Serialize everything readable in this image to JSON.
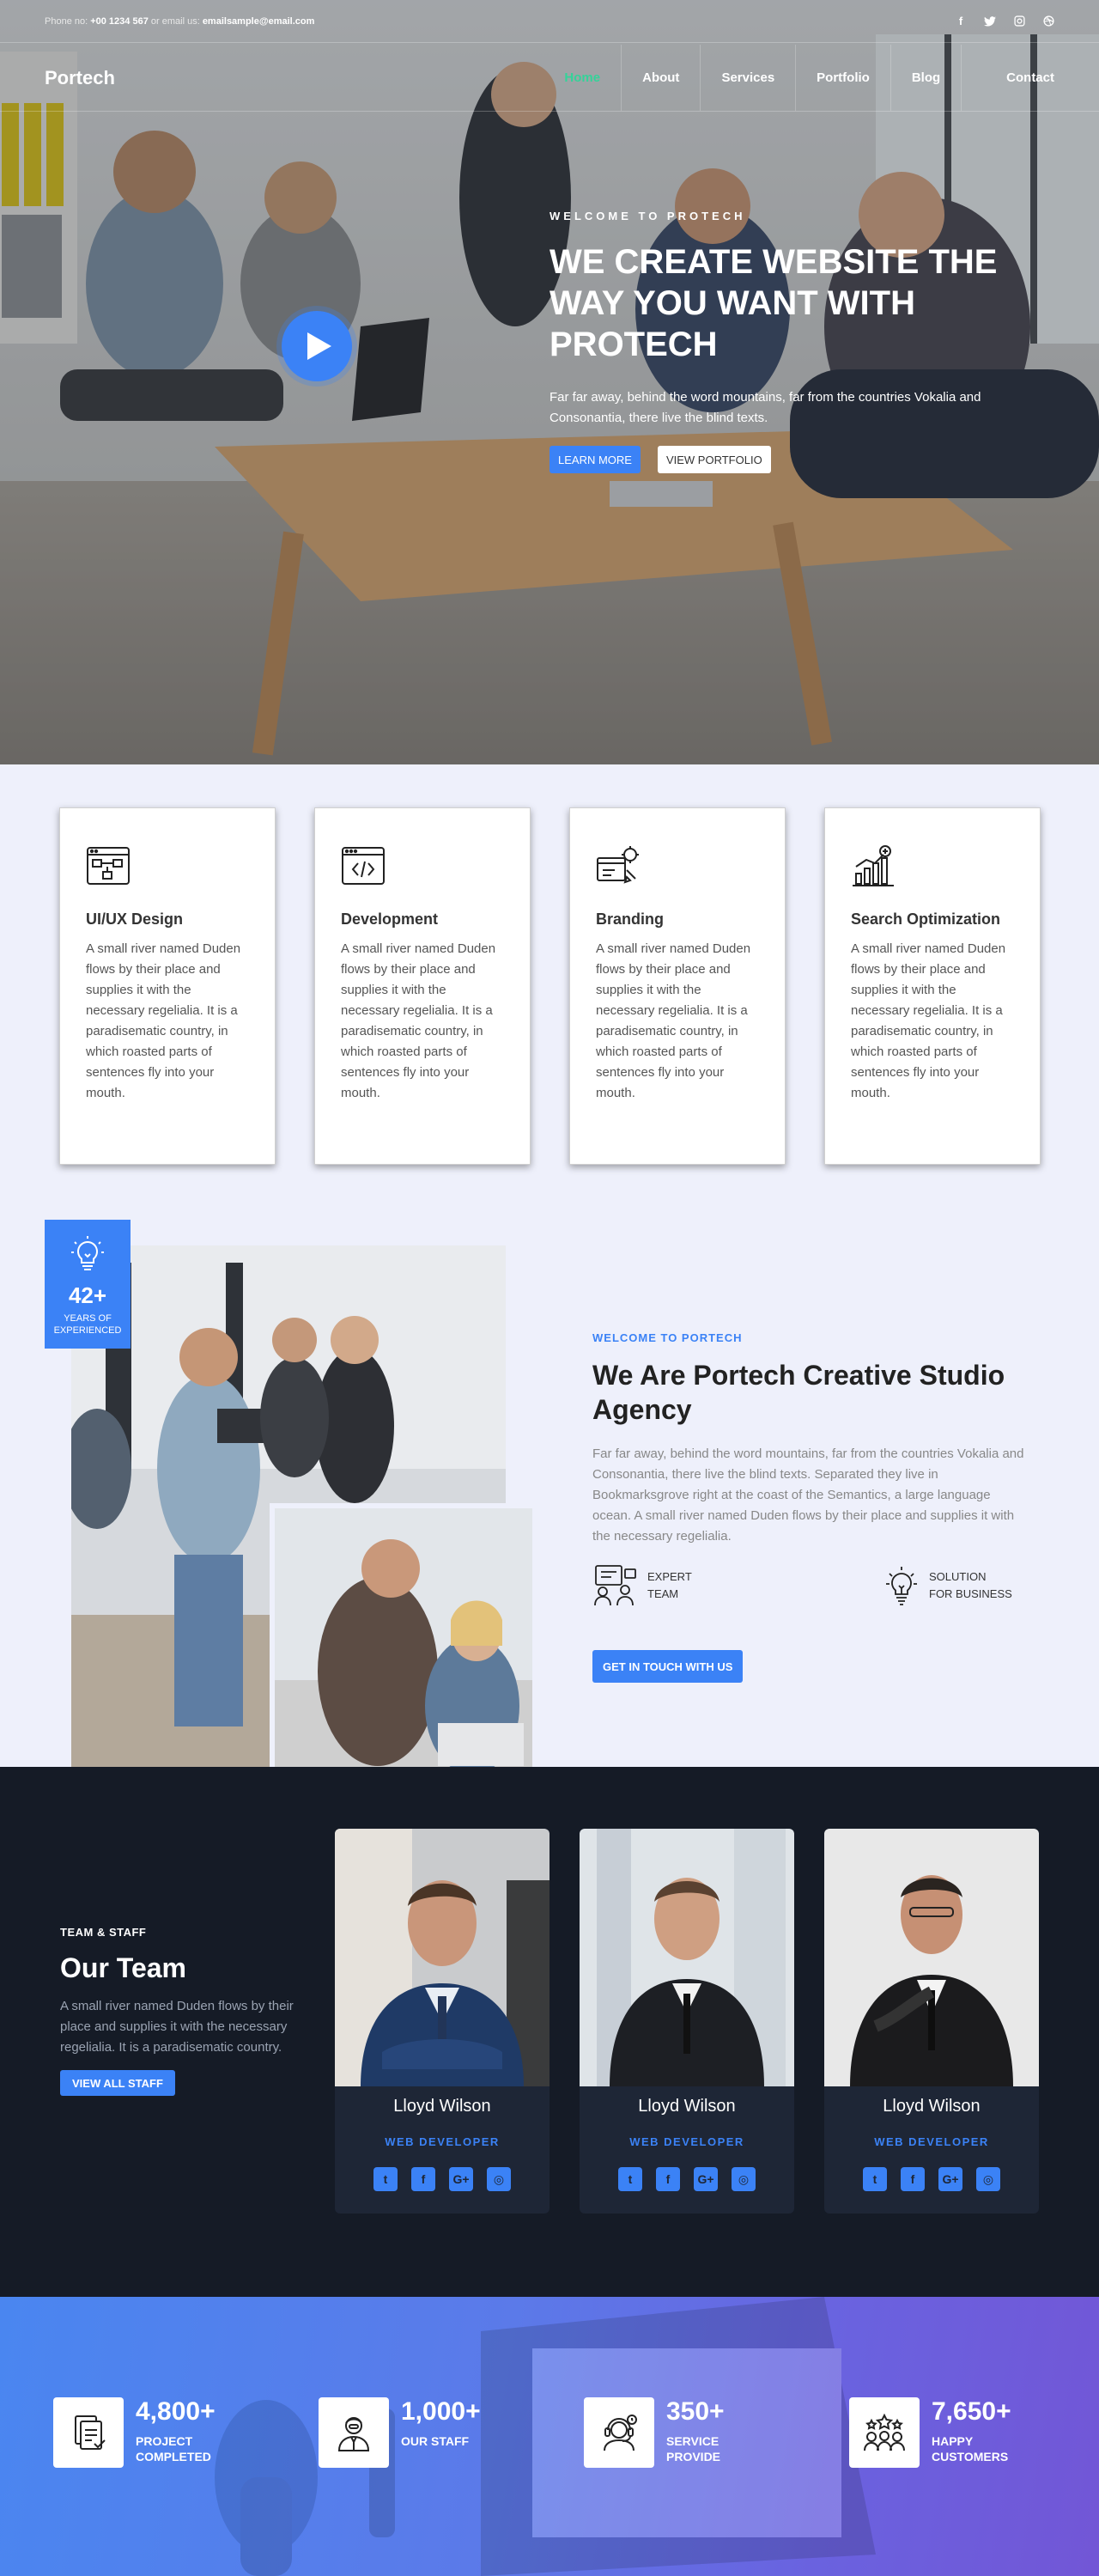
{
  "topbar": {
    "phone_label": "Phone no:",
    "phone": "+00 1234 567",
    "email_label": "or email us:",
    "email": "emailsample@email.com",
    "socials": [
      "facebook-icon",
      "twitter-icon",
      "instagram-icon",
      "dribbble-icon"
    ]
  },
  "nav": {
    "brand": "Portech",
    "items": [
      "Home",
      "About",
      "Services",
      "Portfolio",
      "Blog",
      "Contact"
    ],
    "active": "Home"
  },
  "hero": {
    "kicker": "WELCOME TO PROTECH",
    "title": "WE CREATE WEBSITE THE WAY YOU WANT WITH PROTECH",
    "text": "Far far away, behind the word mountains, far from the countries Vokalia and Consonantia, there live the blind texts.",
    "btn_primary": "LEARN MORE",
    "btn_secondary": "VIEW PORTFOLIO"
  },
  "services": [
    {
      "title": "UI/UX Design",
      "icon": "ui-ux-design-icon",
      "text": "A small river named Duden flows by their place and supplies it with the necessary regelialia. It is a paradisematic country, in which roasted parts of sentences fly into your mouth."
    },
    {
      "title": "Development",
      "icon": "code-window-icon",
      "text": "A small river named Duden flows by their place and supplies it with the necessary regelialia. It is a paradisematic country, in which roasted parts of sentences fly into your mouth."
    },
    {
      "title": "Branding",
      "icon": "branding-icon",
      "text": "A small river named Duden flows by their place and supplies it with the necessary regelialia. It is a paradisematic country, in which roasted parts of sentences fly into your mouth."
    },
    {
      "title": "Search Optimization",
      "icon": "seo-chart-icon",
      "text": "A small river named Duden flows by their place and supplies it with the necessary regelialia. It is a paradisematic country, in which roasted parts of sentences fly into your mouth."
    }
  ],
  "about": {
    "exp_number": "42+",
    "exp_label": "YEARS OF EXPERIENCED",
    "kicker": "WELCOME TO PORTECH",
    "title": "We Are Portech Creative Studio Agency",
    "text": "Far far away, behind the word mountains, far from the countries Vokalia and Consonantia, there live the blind texts. Separated they live in Bookmarksgrove right at the coast of the Semantics, a large language ocean. A small river named Duden flows by their place and supplies it with the necessary regelialia.",
    "features": [
      {
        "line1": "EXPERT",
        "line2": "TEAM",
        "icon": "expert-team-icon"
      },
      {
        "line1": "SOLUTION",
        "line2": "FOR BUSINESS",
        "icon": "lightbulb-icon"
      }
    ],
    "button": "GET IN TOUCH WITH US"
  },
  "team": {
    "kicker": "TEAM & STAFF",
    "title": "Our Team",
    "text": "A small river named Duden flows by their place and supplies it with the necessary regelialia. It is a paradisematic country.",
    "button": "VIEW ALL STAFF",
    "members": [
      {
        "name": "Lloyd Wilson",
        "role": "WEB DEVELOPER"
      },
      {
        "name": "Lloyd Wilson",
        "role": "WEB DEVELOPER"
      },
      {
        "name": "Lloyd Wilson",
        "role": "WEB DEVELOPER"
      }
    ]
  },
  "stats": [
    {
      "number": "4,800+",
      "label1": "PROJECT",
      "label2": "COMPLETED",
      "icon": "documents-icon"
    },
    {
      "number": "1,000+",
      "label1": "OUR STAFF",
      "label2": "",
      "icon": "staff-icon"
    },
    {
      "number": "350+",
      "label1": "SERVICE",
      "label2": "PROVIDE",
      "icon": "support-icon"
    },
    {
      "number": "7,650+",
      "label1": "HAPPY",
      "label2": "CUSTOMERS",
      "icon": "customers-icon"
    }
  ],
  "colors": {
    "accent": "#3b82f6",
    "nav_active": "#34d399",
    "dark": "#151b26",
    "light_bg": "#eef0fb"
  }
}
